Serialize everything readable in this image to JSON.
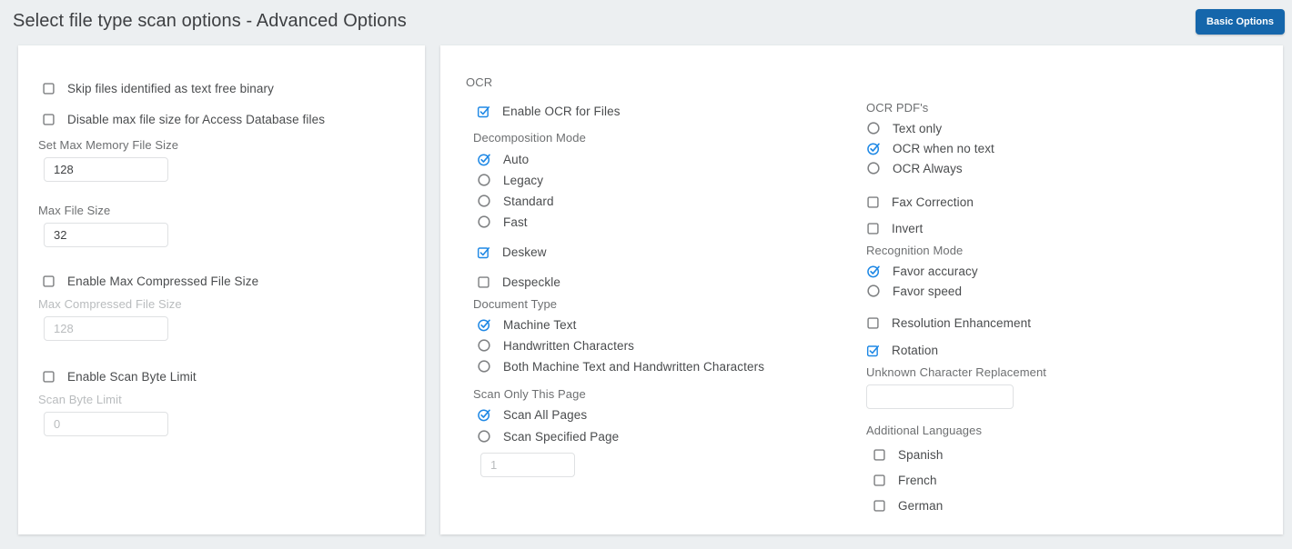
{
  "header": {
    "title": "Select file type scan options - Advanced Options",
    "basic_options_label": "Basic Options"
  },
  "colors": {
    "background": "#eceff1",
    "accent_blue": "#1e88e5",
    "button_blue": "#1566ab"
  },
  "left_panel": {
    "skip_binary": {
      "label": "Skip files identified as text free binary",
      "checked": false
    },
    "disable_max_access": {
      "label": "Disable max file size for Access Database files",
      "checked": false
    },
    "set_max_memory": {
      "label": "Set Max Memory File Size",
      "value": "128",
      "disabled": false
    },
    "max_file_size": {
      "label": "Max File Size",
      "value": "32",
      "disabled": false
    },
    "enable_max_compressed": {
      "label": "Enable Max Compressed File Size",
      "checked": false
    },
    "max_compressed": {
      "label": "Max Compressed File Size",
      "value": "128",
      "disabled": true
    },
    "enable_scan_byte": {
      "label": "Enable Scan Byte Limit",
      "checked": false
    },
    "scan_byte_limit": {
      "label": "Scan Byte Limit",
      "value": "0",
      "disabled": true
    }
  },
  "ocr_panel": {
    "heading": "OCR",
    "enable_ocr": {
      "label": "Enable OCR for Files",
      "checked": true
    },
    "decomposition": {
      "heading": "Decomposition Mode",
      "options": [
        {
          "label": "Auto",
          "selected": true
        },
        {
          "label": "Legacy",
          "selected": false
        },
        {
          "label": "Standard",
          "selected": false
        },
        {
          "label": "Fast",
          "selected": false
        }
      ]
    },
    "deskew": {
      "label": "Deskew",
      "checked": true
    },
    "despeckle": {
      "label": "Despeckle",
      "checked": false
    },
    "document_type": {
      "heading": "Document Type",
      "options": [
        {
          "label": "Machine Text",
          "selected": true
        },
        {
          "label": "Handwritten Characters",
          "selected": false
        },
        {
          "label": "Both Machine Text and Handwritten Characters",
          "selected": false
        }
      ]
    },
    "scan_only": {
      "heading": "Scan Only This Page",
      "options": [
        {
          "label": "Scan All Pages",
          "selected": true
        },
        {
          "label": "Scan Specified Page",
          "selected": false
        }
      ],
      "page_value": "1",
      "page_input_disabled": true
    }
  },
  "ocr_pdf_panel": {
    "heading": "OCR PDF's",
    "options": [
      {
        "label": "Text only",
        "selected": false
      },
      {
        "label": "OCR when no text",
        "selected": true
      },
      {
        "label": "OCR Always",
        "selected": false
      }
    ],
    "fax_correction": {
      "label": "Fax Correction",
      "checked": false
    },
    "invert": {
      "label": "Invert",
      "checked": false
    },
    "recognition": {
      "heading": "Recognition Mode",
      "options": [
        {
          "label": "Favor accuracy",
          "selected": true
        },
        {
          "label": "Favor speed",
          "selected": false
        }
      ]
    },
    "resolution_enhancement": {
      "label": "Resolution Enhancement",
      "checked": false
    },
    "rotation": {
      "label": "Rotation",
      "checked": true
    },
    "unknown_char": {
      "label": "Unknown Character Replacement",
      "value": ""
    },
    "additional_languages": {
      "heading": "Additional Languages",
      "options": [
        {
          "label": "Spanish",
          "checked": false
        },
        {
          "label": "French",
          "checked": false
        },
        {
          "label": "German",
          "checked": false
        }
      ]
    }
  }
}
